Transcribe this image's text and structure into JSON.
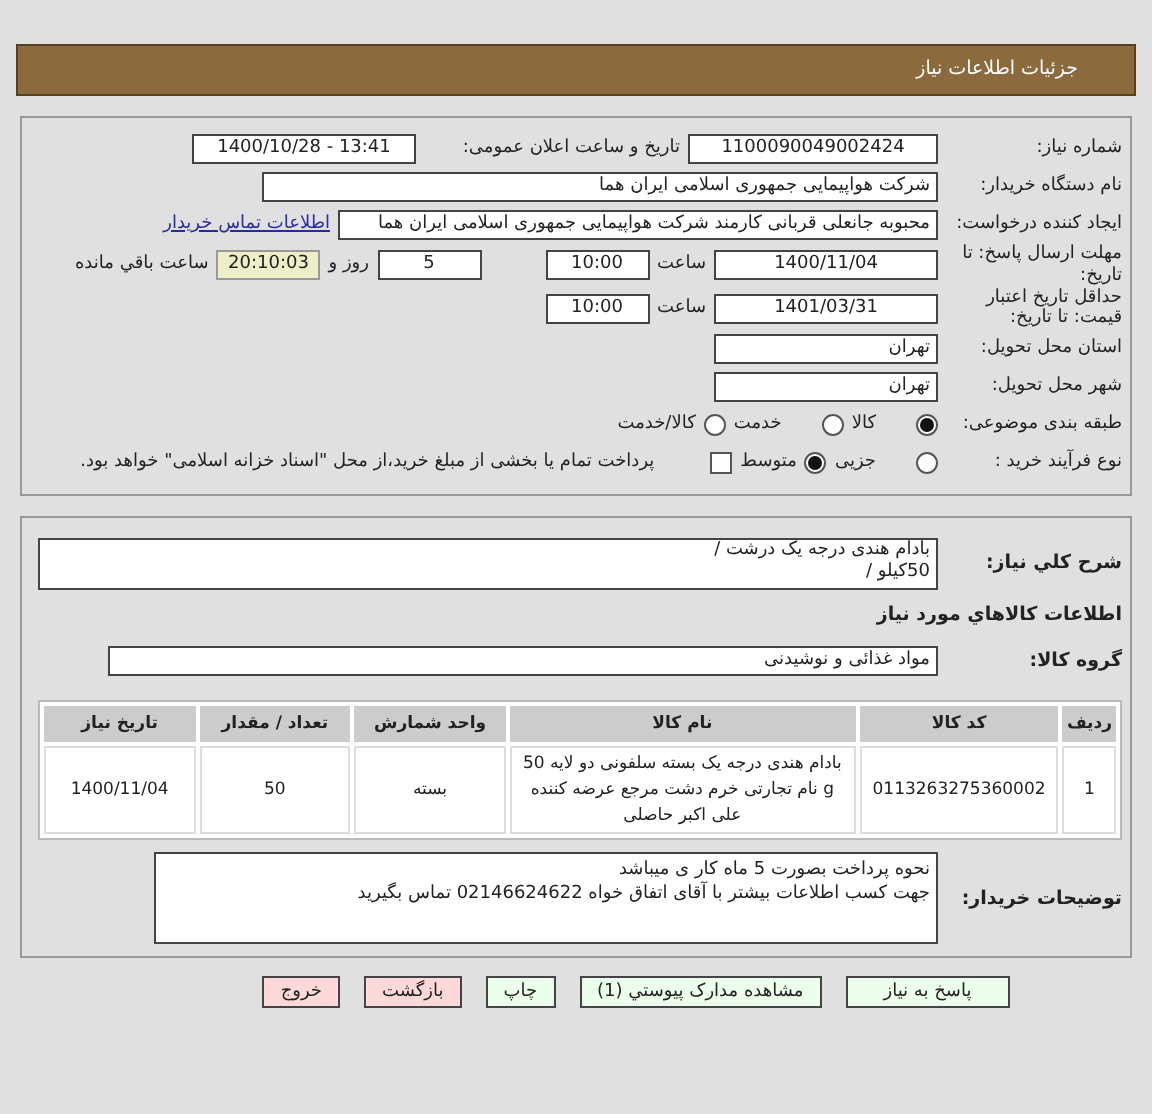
{
  "header": {
    "title": "جزئیات اطلاعات نیاز"
  },
  "info": {
    "need_number": {
      "label": "شماره نیاز:",
      "value": "1100090049002424"
    },
    "announce": {
      "label": "تاریخ و ساعت اعلان عمومی:",
      "value": "1400/10/28 - 13:41"
    },
    "buyer": {
      "label": "نام دستگاه خریدار:",
      "value": "شرکت هواپیمایی جمهوری اسلامی ایران هما"
    },
    "requester": {
      "label": "ایجاد کننده درخواست:",
      "value": "محبوبه جانعلی قربانی کارمند شرکت هواپیمایی جمهوری اسلامی ایران هما",
      "link": "اطلاعات تماس خریدار"
    },
    "deadline": {
      "label": "مهلت ارسال پاسخ: تا تاریخ:",
      "date": "1400/11/04",
      "time_label": "ساعت",
      "time": "10:00",
      "days": "5",
      "days_label": "روز و",
      "remaining": "20:10:03",
      "remaining_label": "ساعت باقي مانده"
    },
    "validity": {
      "label": "حداقل تاریخ اعتبار قیمت: تا تاریخ:",
      "date": "1401/03/31",
      "time_label": "ساعت",
      "time": "10:00"
    },
    "province": {
      "label": "استان محل تحویل:",
      "value": "تهران"
    },
    "city": {
      "label": "شهر محل تحویل:",
      "value": "تهران"
    },
    "category": {
      "label": "طبقه بندی موضوعی:",
      "options": [
        {
          "label": "کالا",
          "selected": true
        },
        {
          "label": "خدمت",
          "selected": false
        },
        {
          "label": "کالا/خدمت",
          "selected": false
        }
      ]
    },
    "process": {
      "label": "نوع فرآیند خرید :",
      "options": [
        {
          "label": "جزیی",
          "selected": false
        },
        {
          "label": "متوسط",
          "selected": true
        }
      ],
      "payment": {
        "checked": false,
        "text": "پرداخت تمام یا بخشی از مبلغ خرید،از محل \"اسناد خزانه اسلامی\" خواهد بود."
      }
    }
  },
  "goods": {
    "description": {
      "label": "شرح کلي نیاز:",
      "lines": [
        "بادام هندی درجه یک درشت /",
        "50کیلو /"
      ]
    },
    "section_title": "اطلاعات کالاهاي مورد نیاز",
    "group": {
      "label": "گروه کالا:",
      "value": "مواد غذائی و نوشیدنی"
    },
    "table": {
      "columns": [
        "ردیف",
        "کد کالا",
        "نام کالا",
        "واحد شمارش",
        "تعداد / مقدار",
        "تاریخ نیاز"
      ],
      "rows": [
        [
          "1",
          "0113263275360002",
          "بادام هندی درجه یک بسته سلفونی دو لایه 50 g نام تجارتی خرم دشت مرجع عرضه کننده علی اکبر حاصلی",
          "بسته",
          "50",
          "1400/11/04"
        ]
      ]
    },
    "notes": {
      "label": "توضیحات خریدار:",
      "lines": [
        "نحوه پرداخت بصورت 5 ماه کار ی میباشد",
        "جهت کسب اطلاعات بیشتر با آقای اتفاق خواه 02146624622 تماس بگیرید"
      ]
    }
  },
  "buttons": [
    {
      "label": "پاسخ به نیاز",
      "kind": "go"
    },
    {
      "label": "مشاهده مدارک پیوستي (1)",
      "kind": "go"
    },
    {
      "label": "چاپ",
      "kind": "go"
    },
    {
      "label": "بازگشت",
      "kind": "stop"
    },
    {
      "label": "خروج",
      "kind": "stop"
    }
  ]
}
